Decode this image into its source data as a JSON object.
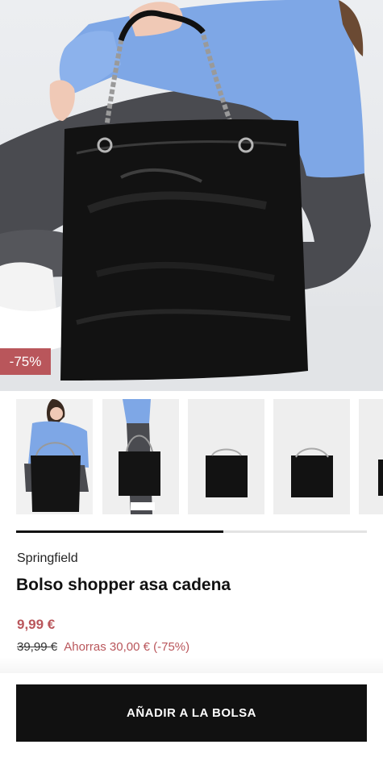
{
  "product": {
    "discount_badge": "-75%",
    "brand": "Springfield",
    "title": "Bolso shopper asa cadena",
    "price": "9,99 €",
    "old_price": "39,99 €",
    "saving": "Ahorras 30,00 € (-75%)"
  },
  "gallery": {
    "thumbnails": [
      {
        "name": "model-seated-bag",
        "selected": true
      },
      {
        "name": "model-standing-bag",
        "selected": false
      },
      {
        "name": "bag-front-view",
        "selected": false
      },
      {
        "name": "bag-angle-view",
        "selected": false
      },
      {
        "name": "bag-side-view",
        "selected": false
      }
    ],
    "scroll_progress": 0.59
  },
  "actions": {
    "add_to_bag_label": "AÑADIR A LA BOLSA"
  },
  "colors": {
    "accent": "#b9565b",
    "button_bg": "#111111",
    "shirt_blue": "#7ea7e6"
  }
}
